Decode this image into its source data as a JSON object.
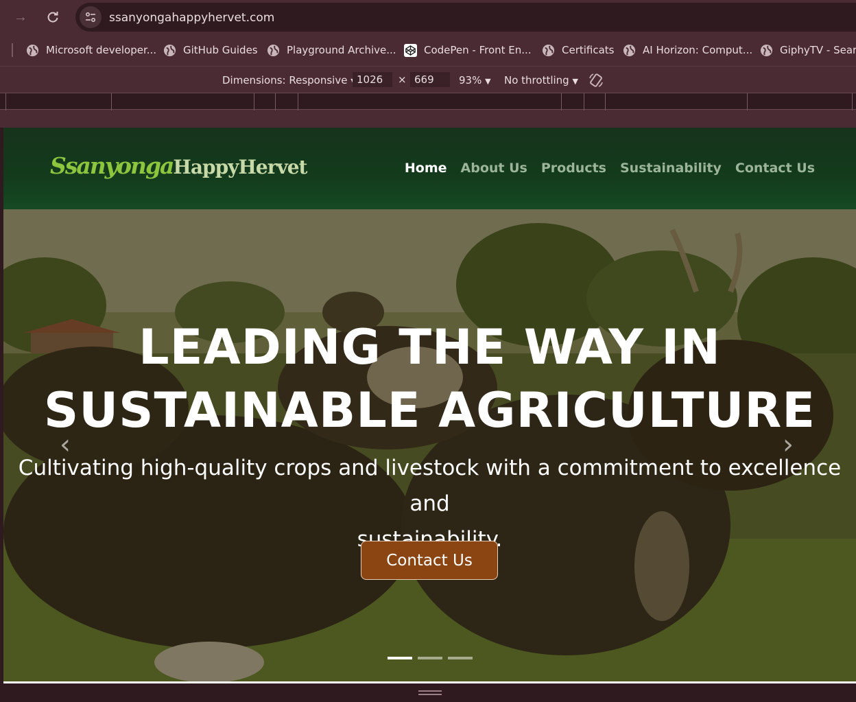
{
  "browser": {
    "url": "ssanyongahappyhervet.com",
    "bookmarks": [
      {
        "label": "Microsoft developer...",
        "icon": "globe-icon"
      },
      {
        "label": "GitHub Guides",
        "icon": "globe-icon"
      },
      {
        "label": "Playground Archive...",
        "icon": "globe-icon"
      },
      {
        "label": "CodePen - Front En...",
        "icon": "codepen-icon"
      },
      {
        "label": "Certificats",
        "icon": "globe-icon"
      },
      {
        "label": "AI Horizon: Comput...",
        "icon": "globe-icon"
      },
      {
        "label": "GiphyTV - Searc",
        "icon": "globe-icon"
      }
    ]
  },
  "devtools": {
    "dimensions_label": "Dimensions: Responsive",
    "width": "1026",
    "times": "×",
    "height": "669",
    "zoom": "93%",
    "throttling": "No throttling"
  },
  "site": {
    "logo_part1": "Ssanyonga",
    "logo_part2": "HappyHervet",
    "nav": [
      "Home",
      "About Us",
      "Products",
      "Sustainability",
      "Contact Us"
    ],
    "active_nav": "Home",
    "hero": {
      "title_line1": "LEADING THE WAY IN",
      "title_line2": "SUSTAINABLE AGRICULTURE",
      "subtitle_line1": "Cultivating high-quality crops and livestock with a commitment to excellence and",
      "subtitle_line2": "sustainability.",
      "cta": "Contact Us",
      "prev_glyph": "‹",
      "next_glyph": "›",
      "slides": 3,
      "active_slide": 1
    }
  },
  "colors": {
    "chrome_bg": "#4a2b33",
    "header_green": "#17331c",
    "logo_green": "#8cc63f",
    "button_brown": "#8b4513"
  }
}
